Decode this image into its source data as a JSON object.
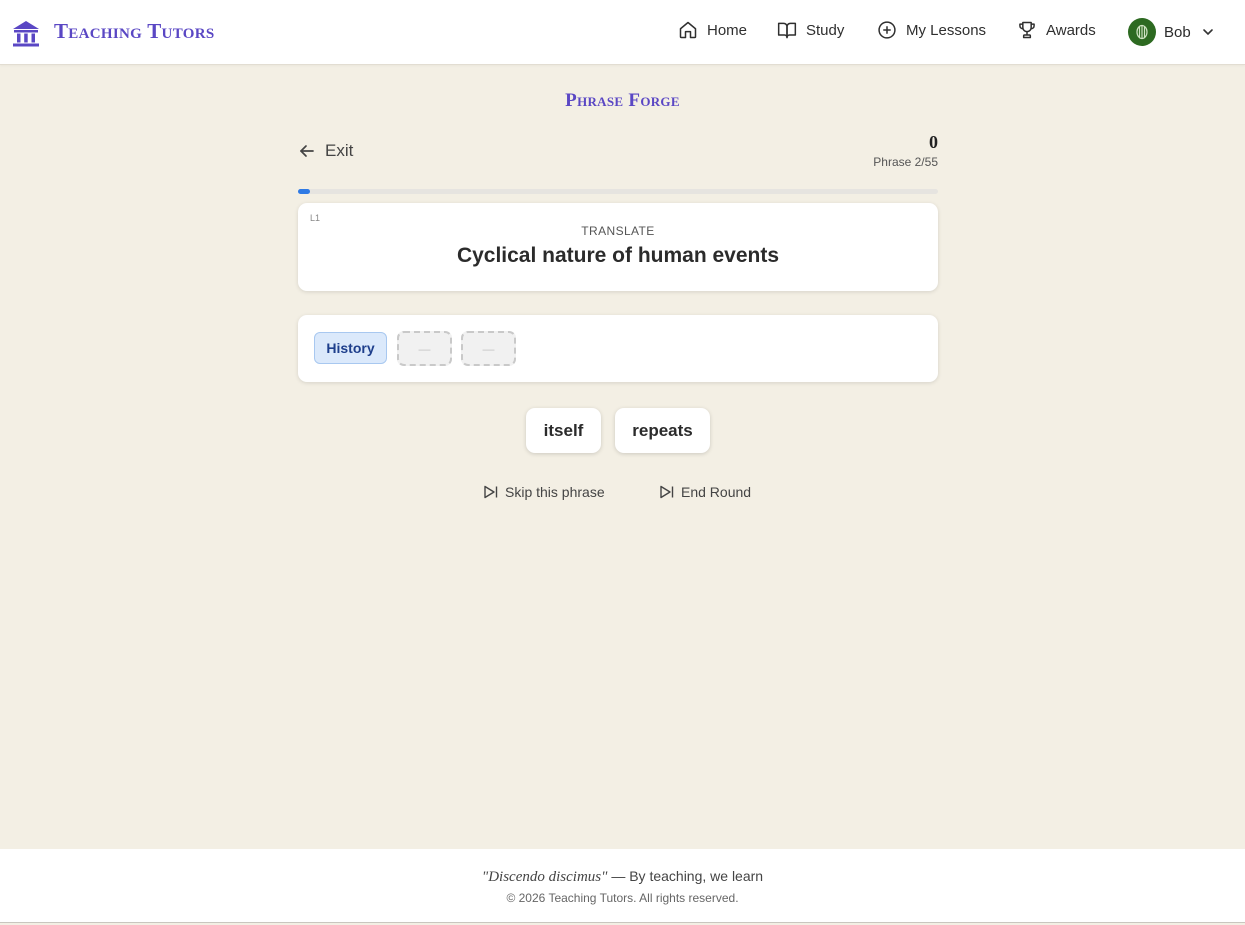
{
  "app": {
    "name": "Teaching Tutors"
  },
  "nav": {
    "items": [
      {
        "label": "Home",
        "icon": "home-icon"
      },
      {
        "label": "Study",
        "icon": "book-icon"
      },
      {
        "label": "My Lessons",
        "icon": "plus-circle-icon"
      },
      {
        "label": "Awards",
        "icon": "trophy-icon"
      }
    ],
    "user": {
      "name": "Bob",
      "avatar_color": "#2d6a21"
    }
  },
  "game": {
    "title": "Phrase Forge",
    "exit_label": "Exit",
    "score": "0",
    "phrase_count": "Phrase 2/55",
    "progress_fraction": 0.018,
    "level": "L1",
    "prompt_label": "TRANSLATE",
    "prompt_text": "Cyclical nature of human events",
    "placed_words": [
      "History"
    ],
    "empty_slot_placeholder": "—",
    "empty_slots": 2,
    "word_bank": [
      "itself",
      "repeats"
    ],
    "skip_label": "Skip this phrase",
    "end_label": "End Round"
  },
  "footer": {
    "motto_latin": "\"Discendo discimus\"",
    "motto_translation": " — By teaching, we learn",
    "copyright": "© 2026 Teaching Tutors. All rights reserved."
  },
  "colors": {
    "brand": "#5a47c4",
    "background": "#f3efe4",
    "progress": "#2f7ae5",
    "chip_bg": "#dbe9fb",
    "chip_text": "#1e3f8c"
  }
}
